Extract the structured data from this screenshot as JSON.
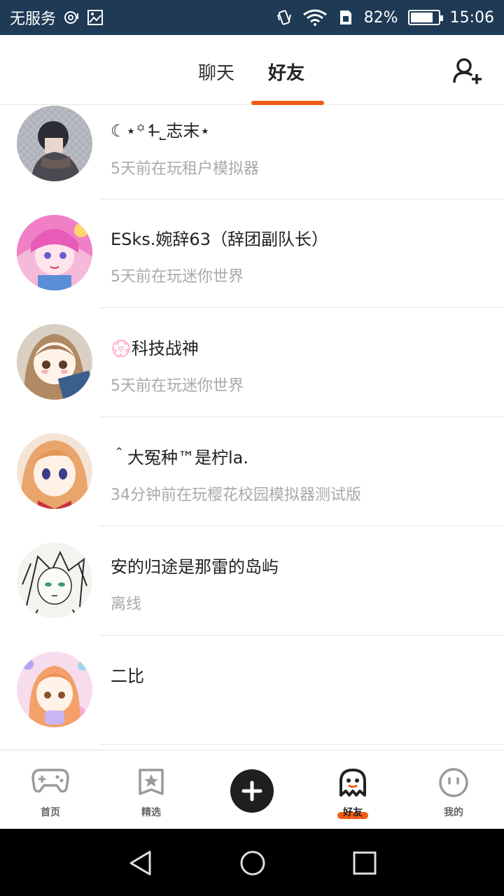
{
  "status_bar": {
    "carrier": "无服务",
    "battery_text": "82%",
    "battery_level": 0.82,
    "time": "15:06",
    "icons": [
      "hotspot-icon",
      "image-icon",
      "vibrate-icon",
      "wifi-icon",
      "sim-icon",
      "battery-icon"
    ]
  },
  "header": {
    "tabs": [
      {
        "label": "聊天",
        "active": false
      },
      {
        "label": "好友",
        "active": true
      }
    ],
    "add_friend_icon": "add-user-icon",
    "accent_color": "#f25a14"
  },
  "friends": [
    {
      "name": "☾⋆꙳↿̶˾志末⋆",
      "status": "5天前在玩租户模拟器"
    },
    {
      "name": "ESks.婉辞63（辞团副队长）",
      "status": "5天前在玩迷你世界"
    },
    {
      "name": "💮科技战神",
      "status": "5天前在玩迷你世界"
    },
    {
      "name": "＾大冤种™是柠la.",
      "status": "34分钟前在玩樱花校园模拟器测试版"
    },
    {
      "name": "安的归途是那雷的岛屿",
      "status": "离线"
    },
    {
      "name": "二比",
      "status": ""
    }
  ],
  "bottom_nav": [
    {
      "label": "首页",
      "icon": "gamepad-icon",
      "active": false
    },
    {
      "label": "精选",
      "icon": "star-bookmark-icon",
      "active": false
    },
    {
      "label": "",
      "icon": "plus-icon",
      "active": false
    },
    {
      "label": "好友",
      "icon": "ghost-icon",
      "active": true
    },
    {
      "label": "我的",
      "icon": "smiley-icon",
      "active": false
    }
  ],
  "system_nav": [
    "back-icon",
    "home-icon",
    "recents-icon"
  ]
}
